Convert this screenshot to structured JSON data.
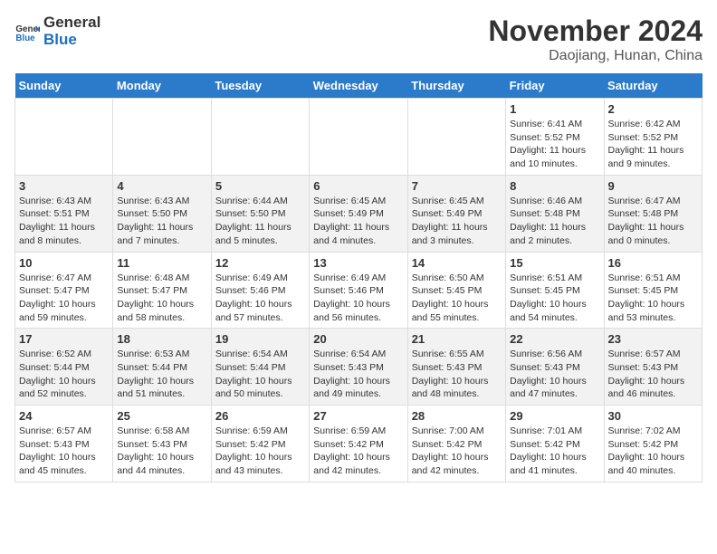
{
  "logo": {
    "text_general": "General",
    "text_blue": "Blue"
  },
  "title": "November 2024",
  "subtitle": "Daojiang, Hunan, China",
  "days_of_week": [
    "Sunday",
    "Monday",
    "Tuesday",
    "Wednesday",
    "Thursday",
    "Friday",
    "Saturday"
  ],
  "weeks": [
    [
      {
        "day": "",
        "content": ""
      },
      {
        "day": "",
        "content": ""
      },
      {
        "day": "",
        "content": ""
      },
      {
        "day": "",
        "content": ""
      },
      {
        "day": "",
        "content": ""
      },
      {
        "day": "1",
        "content": "Sunrise: 6:41 AM\nSunset: 5:52 PM\nDaylight: 11 hours and 10 minutes."
      },
      {
        "day": "2",
        "content": "Sunrise: 6:42 AM\nSunset: 5:52 PM\nDaylight: 11 hours and 9 minutes."
      }
    ],
    [
      {
        "day": "3",
        "content": "Sunrise: 6:43 AM\nSunset: 5:51 PM\nDaylight: 11 hours and 8 minutes."
      },
      {
        "day": "4",
        "content": "Sunrise: 6:43 AM\nSunset: 5:50 PM\nDaylight: 11 hours and 7 minutes."
      },
      {
        "day": "5",
        "content": "Sunrise: 6:44 AM\nSunset: 5:50 PM\nDaylight: 11 hours and 5 minutes."
      },
      {
        "day": "6",
        "content": "Sunrise: 6:45 AM\nSunset: 5:49 PM\nDaylight: 11 hours and 4 minutes."
      },
      {
        "day": "7",
        "content": "Sunrise: 6:45 AM\nSunset: 5:49 PM\nDaylight: 11 hours and 3 minutes."
      },
      {
        "day": "8",
        "content": "Sunrise: 6:46 AM\nSunset: 5:48 PM\nDaylight: 11 hours and 2 minutes."
      },
      {
        "day": "9",
        "content": "Sunrise: 6:47 AM\nSunset: 5:48 PM\nDaylight: 11 hours and 0 minutes."
      }
    ],
    [
      {
        "day": "10",
        "content": "Sunrise: 6:47 AM\nSunset: 5:47 PM\nDaylight: 10 hours and 59 minutes."
      },
      {
        "day": "11",
        "content": "Sunrise: 6:48 AM\nSunset: 5:47 PM\nDaylight: 10 hours and 58 minutes."
      },
      {
        "day": "12",
        "content": "Sunrise: 6:49 AM\nSunset: 5:46 PM\nDaylight: 10 hours and 57 minutes."
      },
      {
        "day": "13",
        "content": "Sunrise: 6:49 AM\nSunset: 5:46 PM\nDaylight: 10 hours and 56 minutes."
      },
      {
        "day": "14",
        "content": "Sunrise: 6:50 AM\nSunset: 5:45 PM\nDaylight: 10 hours and 55 minutes."
      },
      {
        "day": "15",
        "content": "Sunrise: 6:51 AM\nSunset: 5:45 PM\nDaylight: 10 hours and 54 minutes."
      },
      {
        "day": "16",
        "content": "Sunrise: 6:51 AM\nSunset: 5:45 PM\nDaylight: 10 hours and 53 minutes."
      }
    ],
    [
      {
        "day": "17",
        "content": "Sunrise: 6:52 AM\nSunset: 5:44 PM\nDaylight: 10 hours and 52 minutes."
      },
      {
        "day": "18",
        "content": "Sunrise: 6:53 AM\nSunset: 5:44 PM\nDaylight: 10 hours and 51 minutes."
      },
      {
        "day": "19",
        "content": "Sunrise: 6:54 AM\nSunset: 5:44 PM\nDaylight: 10 hours and 50 minutes."
      },
      {
        "day": "20",
        "content": "Sunrise: 6:54 AM\nSunset: 5:43 PM\nDaylight: 10 hours and 49 minutes."
      },
      {
        "day": "21",
        "content": "Sunrise: 6:55 AM\nSunset: 5:43 PM\nDaylight: 10 hours and 48 minutes."
      },
      {
        "day": "22",
        "content": "Sunrise: 6:56 AM\nSunset: 5:43 PM\nDaylight: 10 hours and 47 minutes."
      },
      {
        "day": "23",
        "content": "Sunrise: 6:57 AM\nSunset: 5:43 PM\nDaylight: 10 hours and 46 minutes."
      }
    ],
    [
      {
        "day": "24",
        "content": "Sunrise: 6:57 AM\nSunset: 5:43 PM\nDaylight: 10 hours and 45 minutes."
      },
      {
        "day": "25",
        "content": "Sunrise: 6:58 AM\nSunset: 5:43 PM\nDaylight: 10 hours and 44 minutes."
      },
      {
        "day": "26",
        "content": "Sunrise: 6:59 AM\nSunset: 5:42 PM\nDaylight: 10 hours and 43 minutes."
      },
      {
        "day": "27",
        "content": "Sunrise: 6:59 AM\nSunset: 5:42 PM\nDaylight: 10 hours and 42 minutes."
      },
      {
        "day": "28",
        "content": "Sunrise: 7:00 AM\nSunset: 5:42 PM\nDaylight: 10 hours and 42 minutes."
      },
      {
        "day": "29",
        "content": "Sunrise: 7:01 AM\nSunset: 5:42 PM\nDaylight: 10 hours and 41 minutes."
      },
      {
        "day": "30",
        "content": "Sunrise: 7:02 AM\nSunset: 5:42 PM\nDaylight: 10 hours and 40 minutes."
      }
    ]
  ]
}
